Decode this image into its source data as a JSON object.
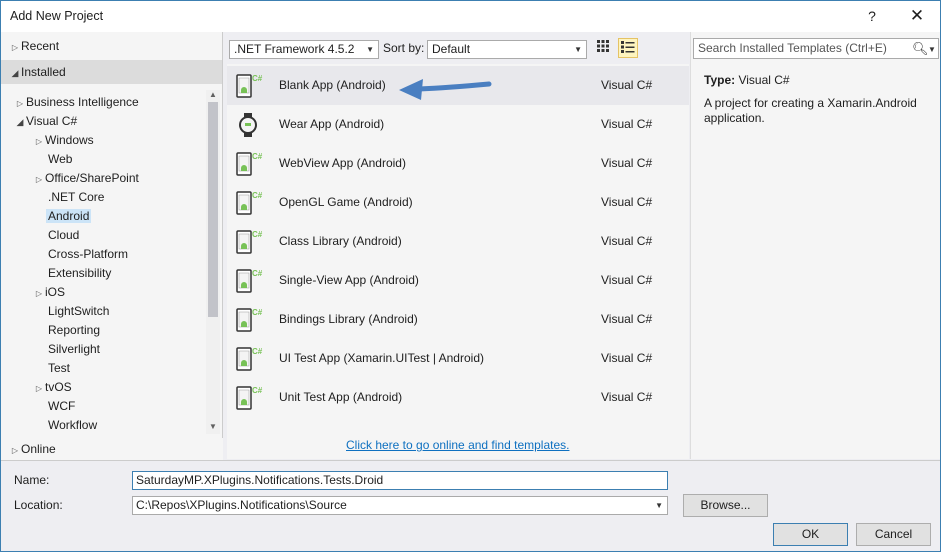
{
  "window": {
    "title": "Add New Project",
    "help": "?",
    "close": "✕"
  },
  "tree": {
    "recent": "Recent",
    "installed": "Installed",
    "items": [
      "Business Intelligence",
      "Visual C#",
      "Windows",
      "Web",
      "Office/SharePoint",
      ".NET Core",
      "Android",
      "Cloud",
      "Cross-Platform",
      "Extensibility",
      "iOS",
      "LightSwitch",
      "Reporting",
      "Silverlight",
      "Test",
      "tvOS",
      "WCF",
      "Workflow"
    ],
    "online": "Online"
  },
  "toolbar": {
    "framework": ".NET Framework 4.5.2",
    "sort_label": "Sort by:",
    "sort_value": "Default"
  },
  "templates": [
    {
      "name": "Blank App (Android)",
      "lang": "Visual C#",
      "icon": "android-blank-app-icon"
    },
    {
      "name": "Wear App (Android)",
      "lang": "Visual C#",
      "icon": "android-wear-icon"
    },
    {
      "name": "WebView App (Android)",
      "lang": "Visual C#",
      "icon": "android-webview-icon"
    },
    {
      "name": "OpenGL Game (Android)",
      "lang": "Visual C#",
      "icon": "android-opengl-icon"
    },
    {
      "name": "Class Library (Android)",
      "lang": "Visual C#",
      "icon": "android-class-library-icon"
    },
    {
      "name": "Single-View App (Android)",
      "lang": "Visual C#",
      "icon": "android-single-view-icon"
    },
    {
      "name": "Bindings Library (Android)",
      "lang": "Visual C#",
      "icon": "android-bindings-icon"
    },
    {
      "name": "UI Test App (Xamarin.UITest | Android)",
      "lang": "Visual C#",
      "icon": "android-uitest-icon"
    },
    {
      "name": "Unit Test App (Android)",
      "lang": "Visual C#",
      "icon": "android-unittest-icon"
    }
  ],
  "online_link": "Click here to go online and find templates.",
  "details": {
    "search_placeholder": "Search Installed Templates (Ctrl+E)",
    "type_label": "Type:",
    "type_value": "Visual C#",
    "description": "A project for creating a Xamarin.Android application."
  },
  "bottom": {
    "name_label": "Name:",
    "name_value": "SaturdayMP.XPlugins.Notifications.Tests.Droid",
    "location_label": "Location:",
    "location_value": "C:\\Repos\\XPlugins.Notifications\\Source",
    "browse": "Browse...",
    "ok": "OK",
    "cancel": "Cancel"
  },
  "colors": {
    "accent": "#3c7fb1",
    "link": "#0e70c0",
    "selection": "#cce4f7",
    "android_green": "#78c257"
  }
}
